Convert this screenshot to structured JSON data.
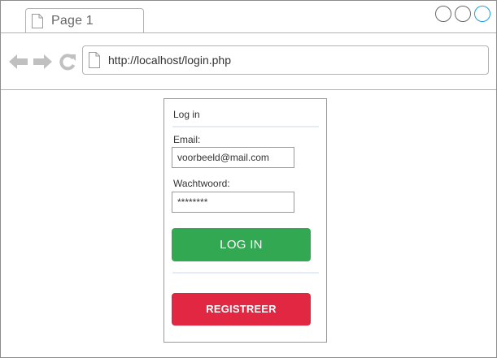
{
  "browser": {
    "tab": {
      "label": "Page 1",
      "icon": "page-icon"
    },
    "window_controls": [
      "minimize-button",
      "maximize-button",
      "close-button"
    ],
    "nav": {
      "back_icon": "back-arrow-icon",
      "forward_icon": "forward-arrow-icon",
      "reload_icon": "reload-icon"
    },
    "address": {
      "url": "http://localhost/login.php",
      "icon": "page-icon"
    },
    "colors": {
      "chrome_border": "#b3b3b3",
      "icon_gray": "#c0c0c0",
      "close_accent": "#1ba1e2"
    }
  },
  "login": {
    "title": "Log in",
    "email": {
      "label": "Email:",
      "value": "voorbeeld@mail.com"
    },
    "password": {
      "label": "Wachtwoord:",
      "value": "********"
    },
    "login_button": "LOG IN",
    "register_button": "REGISTREER",
    "colors": {
      "login": "#33a852",
      "register": "#e12742",
      "divider": "#e3ecf8"
    }
  }
}
